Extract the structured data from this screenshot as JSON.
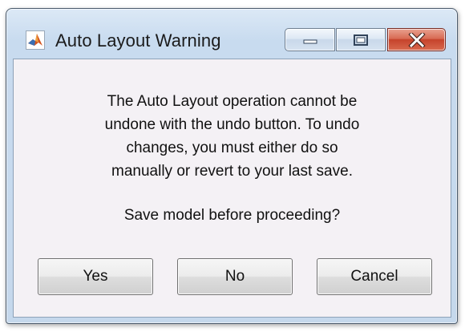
{
  "window": {
    "title": "Auto Layout Warning",
    "app_icon": "matlab-membrane-icon",
    "caption_buttons": {
      "minimize_icon": "minimize-icon",
      "maximize_icon": "maximize-icon",
      "close_icon": "close-icon"
    },
    "colors": {
      "titlebar": "#c8dbef",
      "close_button": "#c5432b",
      "content_background": "#f4f1f5"
    }
  },
  "dialog": {
    "message_lines": [
      "The Auto Layout operation cannot be",
      "undone with the undo button. To undo",
      "changes, you must either do so",
      "manually or revert to your last save."
    ],
    "question": "Save model before proceeding?",
    "buttons": {
      "yes": "Yes",
      "no": "No",
      "cancel": "Cancel"
    }
  }
}
